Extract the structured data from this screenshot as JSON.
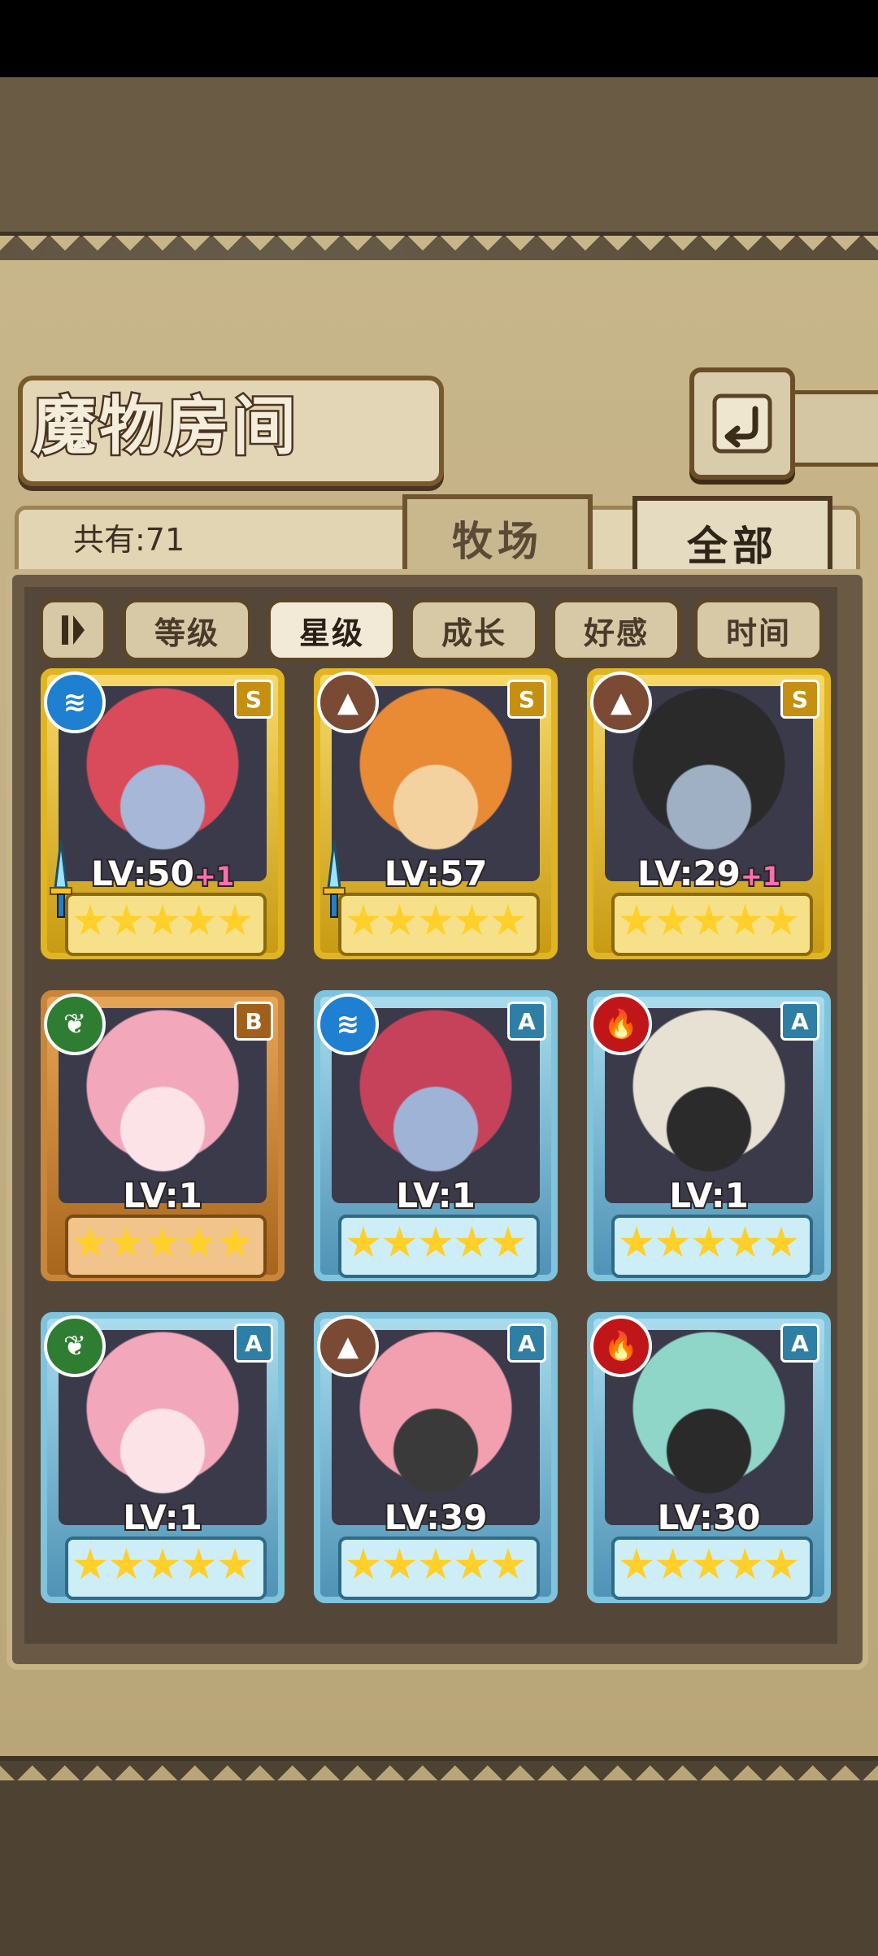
{
  "screen": {
    "title": "魔物房间"
  },
  "header": {
    "count_label": "共有:71"
  },
  "tabs": [
    {
      "label": "牧场",
      "active": false
    },
    {
      "label": "全部",
      "active": true
    }
  ],
  "sort": {
    "toggle_icon": "pause-sort-icon",
    "buttons": [
      {
        "label": "等级",
        "active": false
      },
      {
        "label": "星级",
        "active": true
      },
      {
        "label": "成长",
        "active": false
      },
      {
        "label": "好感",
        "active": false
      },
      {
        "label": "时间",
        "active": false
      }
    ]
  },
  "monsters": [
    {
      "element": "water",
      "rank": "S",
      "level": "LV:50",
      "plus": "+1",
      "stars": 5,
      "frame": "gold",
      "weapon": true,
      "portrait": [
        "#d94a5a",
        "#a7b7d8"
      ]
    },
    {
      "element": "earth",
      "rank": "S",
      "level": "LV:57",
      "plus": "",
      "stars": 5,
      "frame": "gold",
      "weapon": true,
      "portrait": [
        "#e98a34",
        "#f3d2a0"
      ]
    },
    {
      "element": "earth",
      "rank": "S",
      "level": "LV:29",
      "plus": "+1",
      "stars": 5,
      "frame": "gold",
      "weapon": false,
      "portrait": [
        "#2a2a2a",
        "#9fb0c4"
      ]
    },
    {
      "element": "leaf",
      "rank": "B",
      "level": "LV:1",
      "plus": "",
      "stars": 5,
      "frame": "bronze",
      "weapon": false,
      "portrait": [
        "#f2a7bb",
        "#fbe3e8"
      ]
    },
    {
      "element": "water",
      "rank": "A",
      "level": "LV:1",
      "plus": "",
      "stars": 5,
      "frame": "blue",
      "weapon": false,
      "portrait": [
        "#c6425a",
        "#9fb3d6"
      ]
    },
    {
      "element": "fire",
      "rank": "A",
      "level": "LV:1",
      "plus": "",
      "stars": 5,
      "frame": "blue",
      "weapon": false,
      "portrait": [
        "#e6e1d3",
        "#2b2b2b"
      ]
    },
    {
      "element": "leaf",
      "rank": "A",
      "level": "LV:1",
      "plus": "",
      "stars": 5,
      "frame": "blue",
      "weapon": false,
      "portrait": [
        "#f2a7bb",
        "#fbe3e8"
      ]
    },
    {
      "element": "earth",
      "rank": "A",
      "level": "LV:39",
      "plus": "",
      "stars": 5,
      "frame": "blue",
      "weapon": false,
      "portrait": [
        "#f29fb0",
        "#3a3a3a"
      ]
    },
    {
      "element": "fire",
      "rank": "A",
      "level": "LV:30",
      "plus": "",
      "stars": 5,
      "frame": "blue",
      "weapon": false,
      "portrait": [
        "#8fd6c8",
        "#2a2a2a"
      ]
    }
  ],
  "colors": {
    "parchment": "#c8b68b",
    "frame_brown": "#6e5430",
    "star": "#ffcf2a"
  }
}
